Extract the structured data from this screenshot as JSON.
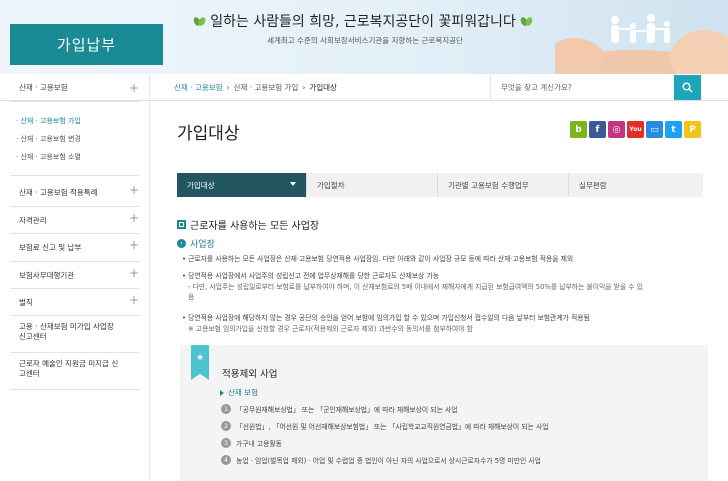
{
  "header": {
    "site_section": "가입납부",
    "slogan": "일하는 사람들의 희망, 근로복지공단이 꽃피워갑니다",
    "subslogan": "세계최고 수준의 사회보장서비스기관을 지향하는 근로복지공단"
  },
  "nav": {
    "category": "산재 · 고용보험",
    "breadcrumb": [
      "산재 · 고용보험",
      "산재 · 고용보험 가입",
      "가입대상"
    ],
    "search_placeholder": "무엇을 찾고 계신가요?"
  },
  "sidebar": {
    "items": [
      {
        "label": "산재 · 고용보험"
      },
      {
        "label": "산재 · 고용보험 적용특례"
      },
      {
        "label": "자격관리"
      },
      {
        "label": "보험료 신고 및 납부"
      },
      {
        "label": "보험사무대행기관"
      },
      {
        "label": "벌칙"
      },
      {
        "label": "고용 · 산재보험 미가입 사업장\n신고센터"
      },
      {
        "label": "근로자 예술인 지원금 미지급 신\n고센터"
      }
    ],
    "subitems": [
      "산재 · 고용보험 가입",
      "산재 · 고용보험 변경",
      "산재 · 고용보험 소멸"
    ]
  },
  "main": {
    "title": "가입대상",
    "social": [
      {
        "label": "b",
        "color": "#7ab51d"
      },
      {
        "label": "f",
        "color": "#3b5998"
      },
      {
        "label": "◎",
        "color": "#c13584"
      },
      {
        "label": "You",
        "color": "#e52d27"
      },
      {
        "label": "▭",
        "color": "#2b8be0"
      },
      {
        "label": "t",
        "color": "#1da1f2"
      },
      {
        "label": "P",
        "color": "#f0c419"
      }
    ],
    "tabs": [
      "가입대상",
      "가입절차",
      "기관별 고용보험 수행업무",
      "실무편람"
    ],
    "section_title": "근로자를 사용하는 모든 사업장",
    "subsection": "사업장",
    "bullets": [
      "근로자를 사용하는 모든 사업장은 산재·고용보험 당연적용 사업장임. 다만 아래와 같이 사업장 규모 등에 따라 산재·고용보험 적용을 제외",
      "당연적용 사업장에서 사업주의 성립신고 전에 업무상재해를 당한 근로자도 산재보상 가능",
      "당연적용 사업장에 해당하지 않는 경우 공단의 승인을 얻어 보험에 임의가입 할 수 있으며 가입신청서 접수일의 다음 날부터 보험관계가 적용됨"
    ],
    "notes": [
      "- 다만, 사업주는 성립일로부터 보험료를 납부하여야 하며, 이 산재보험료의 5배 이내에서 재해자에게 지급된 보험급여액의 50%를 납부하는 불이익을 받을 수 있",
      "음",
      "※ 고용보험 임의가입을 신청할 경우 근로자(적용제외 근로자 제외) 과반수의 동의서를 첨부하여야 함"
    ],
    "box": {
      "title": "적용제외 사업",
      "subtitle": "산재 보험",
      "rows": [
        "「공무원재해보상법」 또는 「군인재해보상법」에 따라 재해보상이 되는 사업",
        "「선원법」, 「어선원 및 어선재해보상보험법」 또는 「사립학교교직원연금법」에 따라 재해보상이 되는 사업",
        "가구내 고용활동",
        "농업 · 임업(벌목업 제외) · 어업 및 수렵업 중 법인이 아닌 자의 사업으로서 상시근로자수가 5명 미만인 사업"
      ]
    }
  }
}
